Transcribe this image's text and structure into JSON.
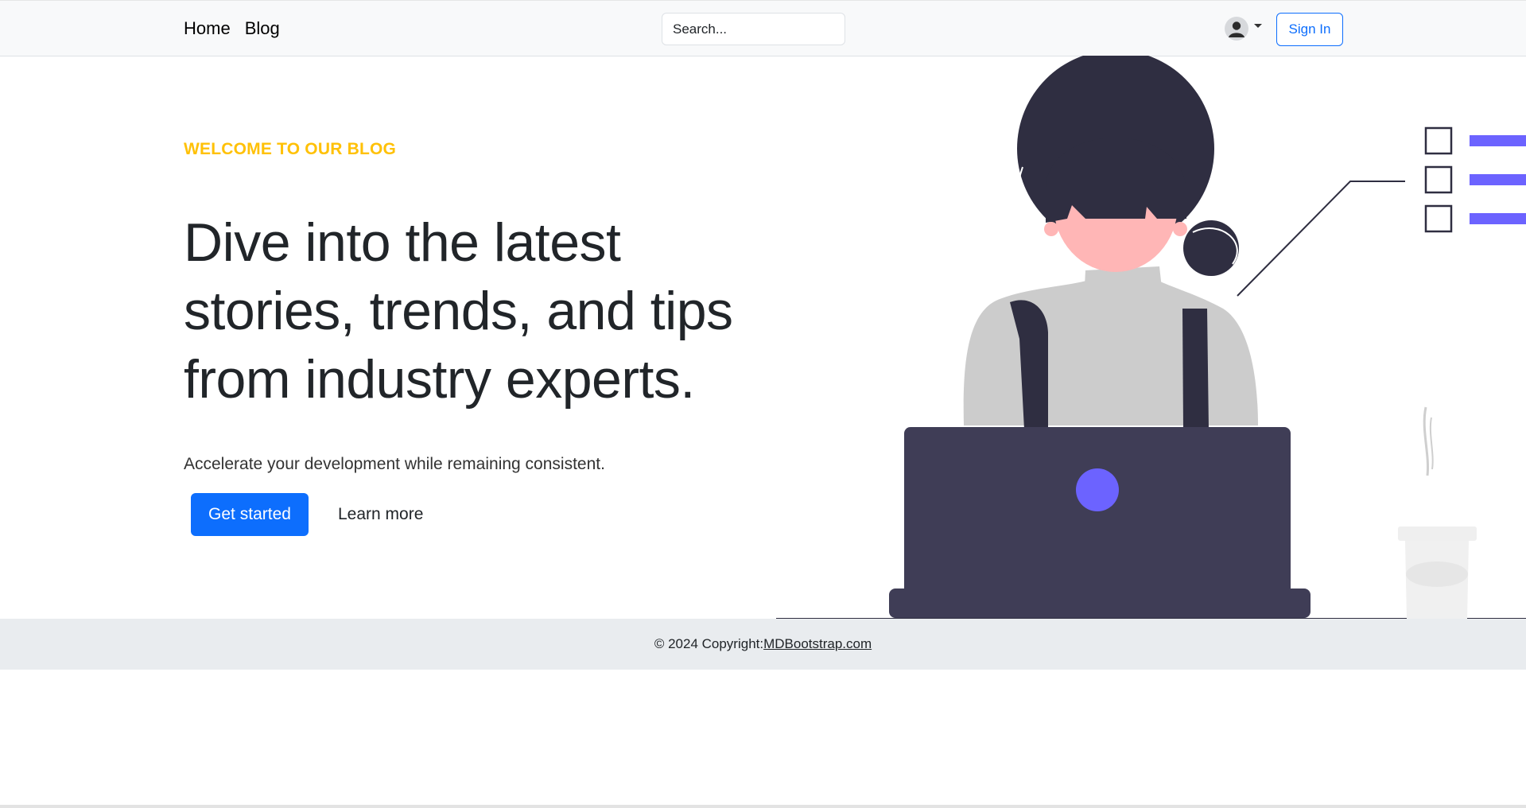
{
  "navbar": {
    "links": [
      {
        "label": "Home"
      },
      {
        "label": "Blog"
      }
    ],
    "search": {
      "placeholder": "Search..."
    },
    "sign_in_label": "Sign In"
  },
  "hero": {
    "eyebrow": "WELCOME TO OUR BLOG",
    "headline_lines": [
      "Dive into the latest",
      "stories, trends, and tips",
      "from industry experts."
    ],
    "lead": "Accelerate your development while remaining consistent.",
    "primary_button": "Get started",
    "secondary_button": "Learn more"
  },
  "footer": {
    "copyright": "© 2024 Copyright:",
    "link_text": "MDBootstrap.com"
  },
  "colors": {
    "primary": "#0d6efd",
    "eyebrow": "#ffc107",
    "navbar_bg": "#f8f9fa",
    "footer_bg": "#e9ecef",
    "laptop": "#3f3d56",
    "accent_purple": "#6c63ff",
    "skin": "#ffb6b6",
    "hair": "#2f2e41",
    "shirt": "#cccccc"
  },
  "icons": {
    "avatar": "user-avatar-icon",
    "caret": "caret-down-icon"
  }
}
